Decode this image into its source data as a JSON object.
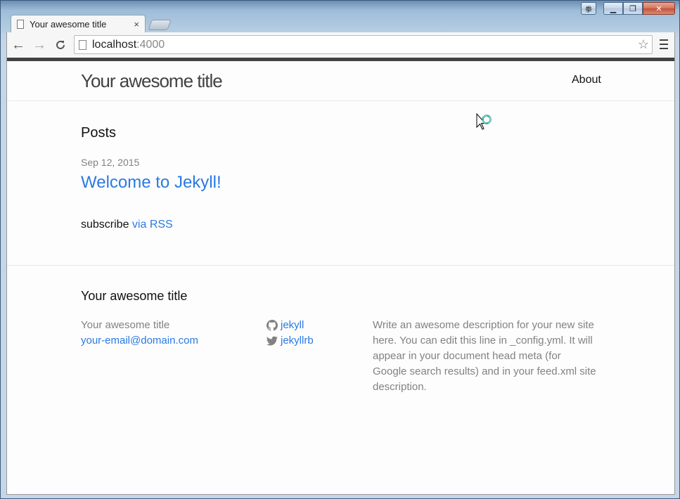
{
  "browser": {
    "tab_title": "Your awesome title",
    "tab_close": "×",
    "url_host": "localhost",
    "url_port": ":4000",
    "lang_indicator": "拳",
    "win_min": "▁",
    "win_max": "❐",
    "win_close": "✕",
    "back": "←",
    "forward": "→",
    "reload": "C",
    "star": "☆"
  },
  "header": {
    "site_title": "Your awesome title",
    "nav_about": "About"
  },
  "main": {
    "posts_heading": "Posts",
    "post": {
      "date": "Sep 12, 2015",
      "title": "Welcome to Jekyll!"
    },
    "rss_prefix": "subscribe ",
    "rss_link": "via RSS"
  },
  "footer": {
    "heading": "Your awesome title",
    "site_name": "Your awesome title",
    "email": "your-email@domain.com",
    "github": "jekyll",
    "twitter": "jekyllrb",
    "description": "Write an awesome description for your new site here. You can edit this line in _config.yml. It will appear in your document head meta (for Google search results) and in your feed.xml site description."
  },
  "colors": {
    "link": "#2a7ae2",
    "meta": "#828282",
    "header_border": "#424242"
  }
}
